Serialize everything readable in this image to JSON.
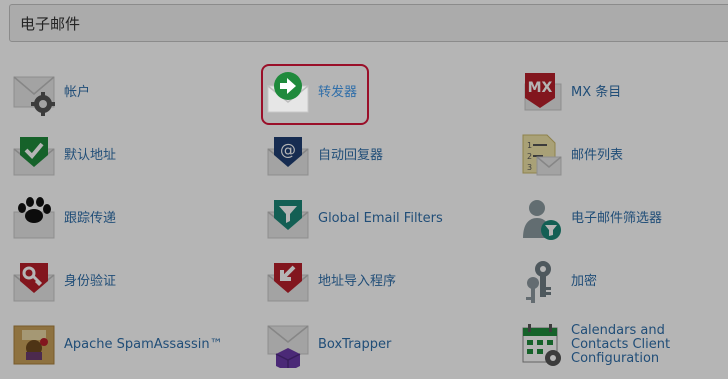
{
  "section": {
    "title": "电子邮件"
  },
  "items": [
    {
      "label": "帐户",
      "icon": "mail-gear-icon"
    },
    {
      "label": "转发器",
      "icon": "mail-forward-arrow-icon",
      "highlighted": true
    },
    {
      "label": "MX 条目",
      "icon": "mx-record-icon"
    },
    {
      "label": "默认地址",
      "icon": "mail-checkmark-icon"
    },
    {
      "label": "自动回复器",
      "icon": "mail-at-sign-icon"
    },
    {
      "label": "邮件列表",
      "icon": "mailing-list-icon"
    },
    {
      "label": "跟踪传递",
      "icon": "paw-print-icon"
    },
    {
      "label": "Global Email Filters",
      "icon": "mail-filter-funnel-icon"
    },
    {
      "label": "电子邮件筛选器",
      "icon": "user-filter-icon"
    },
    {
      "label": "身份验证",
      "icon": "mail-key-icon"
    },
    {
      "label": "地址导入程序",
      "icon": "mail-import-arrow-icon"
    },
    {
      "label": "加密",
      "icon": "keys-icon"
    },
    {
      "label": "Apache SpamAssassin™",
      "icon": "spamassassin-icon"
    },
    {
      "label": "BoxTrapper",
      "icon": "mail-box-cube-icon"
    },
    {
      "label": "Calendars and Contacts Client Configuration",
      "icon": "calendar-icon"
    }
  ],
  "colors": {
    "link": "#2f6ea9",
    "highlight_border": "#d9163a",
    "green": "#1f8a3c",
    "red": "#b8202b",
    "navy": "#1f3f73",
    "teal": "#1b8777"
  }
}
